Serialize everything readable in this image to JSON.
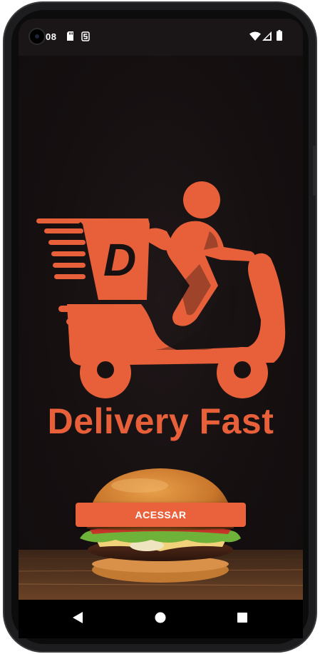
{
  "status_bar": {
    "time": "08",
    "icons": [
      "sd-card-icon",
      "s-notification-icon",
      "wifi-icon",
      "signal-icon",
      "battery-icon"
    ]
  },
  "app": {
    "name": "Delivery Fast",
    "logo_letter": "D",
    "access_button_label": "ACESSAR",
    "accent_color": "#e9623b"
  },
  "nav_bar": {
    "buttons": [
      "back-icon",
      "home-icon",
      "recents-icon"
    ]
  }
}
